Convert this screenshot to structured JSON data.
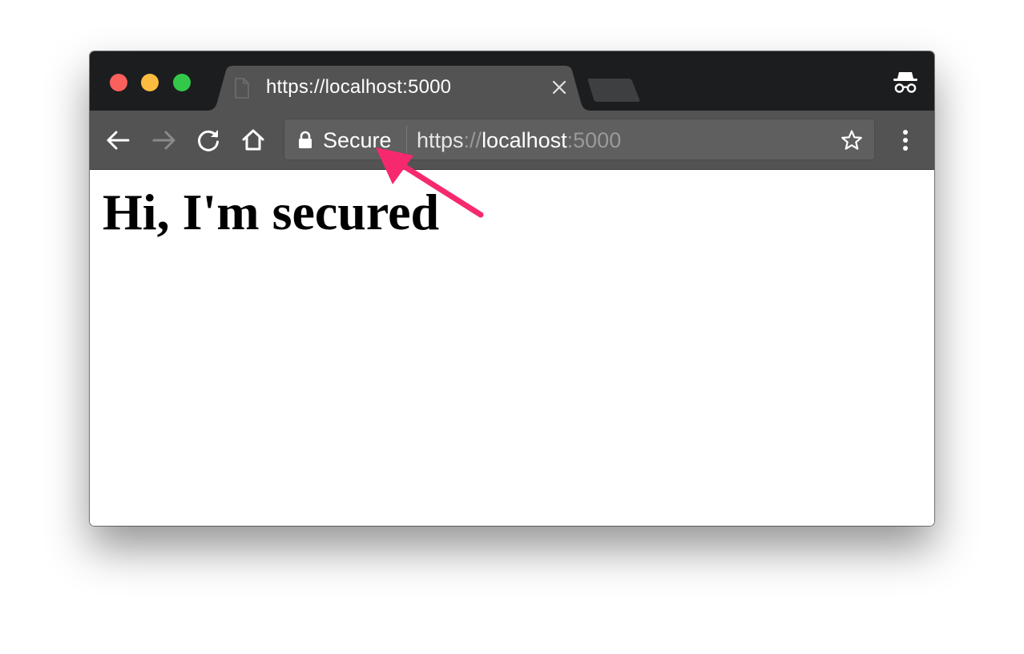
{
  "window": {
    "traffic_lights": {
      "close_color": "#fc605c",
      "minimize_color": "#fdbc40",
      "maximize_color": "#34c84a"
    }
  },
  "tab": {
    "title": "https://localhost:5000",
    "favicon": "document-icon",
    "close": "close-icon"
  },
  "toolbar": {
    "back": "arrow-left-icon",
    "forward": "arrow-right-icon",
    "reload": "reload-icon",
    "home": "home-icon",
    "menu": "vertical-dots-icon"
  },
  "omnibox": {
    "security_label": "Secure",
    "url_scheme": "https",
    "url_sep": "://",
    "url_host": "localhost",
    "url_port": ":5000",
    "bookmark": "star-icon"
  },
  "profile": {
    "icon": "incognito-icon"
  },
  "page": {
    "heading": "Hi, I'm secured"
  },
  "annotation": {
    "arrow_color": "#f7296e"
  }
}
